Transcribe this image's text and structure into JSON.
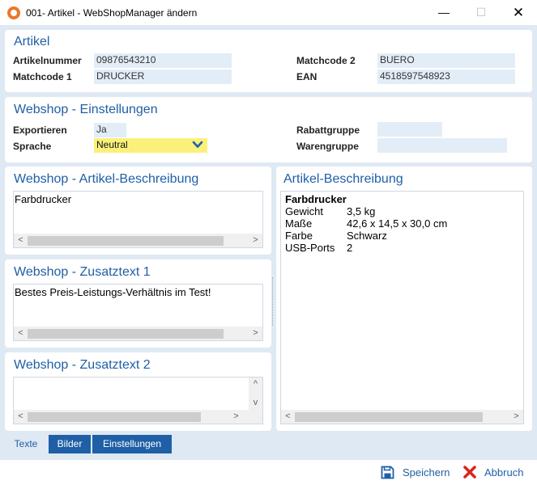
{
  "window": {
    "title": "001- Artikel - WebShopManager ändern",
    "minimize_glyph": "—",
    "maximize_glyph": "☐",
    "close_glyph": "✕"
  },
  "artikel": {
    "title": "Artikel",
    "artikelnummer_label": "Artikelnummer",
    "artikelnummer_value": "09876543210",
    "matchcode1_label": "Matchcode 1",
    "matchcode1_value": "DRUCKER",
    "matchcode2_label": "Matchcode 2",
    "matchcode2_value": "BUERO",
    "ean_label": "EAN",
    "ean_value": "4518597548923"
  },
  "webshop_settings": {
    "title": "Webshop - Einstellungen",
    "exportieren_label": "Exportieren",
    "exportieren_value": "Ja",
    "sprache_label": "Sprache",
    "sprache_value": "Neutral",
    "rabattgruppe_label": "Rabattgruppe",
    "rabattgruppe_value": "",
    "warengruppe_label": "Warengruppe",
    "warengruppe_value": ""
  },
  "webshop_beschreibung": {
    "title": "Webshop - Artikel-Beschreibung",
    "text": "Farbdrucker"
  },
  "zusatztext1": {
    "title": "Webshop - Zusatztext 1",
    "text": "Bestes Preis-Leistungs-Verhältnis im Test!"
  },
  "zusatztext2": {
    "title": "Webshop - Zusatztext 2",
    "text": ""
  },
  "artikel_beschreibung": {
    "title": "Artikel-Beschreibung",
    "heading": "Farbdrucker",
    "rows": [
      {
        "key": "Gewicht",
        "value": "3,5 kg"
      },
      {
        "key": "Maße",
        "value": "42,6 x 14,5 x 30,0 cm"
      },
      {
        "key": "Farbe",
        "value": "Schwarz"
      },
      {
        "key": "USB-Ports",
        "value": "2"
      }
    ]
  },
  "tabs": [
    {
      "label": "Texte",
      "active": true
    },
    {
      "label": "Bilder",
      "active": false
    },
    {
      "label": "Einstellungen",
      "active": false
    }
  ],
  "actions": {
    "save_label": "Speichern",
    "cancel_label": "Abbruch"
  },
  "scroll_glyphs": {
    "left": "<",
    "right": ">",
    "up": "^",
    "down": "v"
  },
  "colors": {
    "accent": "#1f5fa6",
    "field_bg": "#e3edf7",
    "highlight_field": "#fbf07a",
    "panel_bg": "#dfe9f3",
    "cancel_red": "#d9261c"
  },
  "icons": {
    "app": "app-logo-icon",
    "save": "floppy-disk-icon",
    "cancel": "red-x-icon",
    "dropdown": "chevron-down-icon"
  }
}
